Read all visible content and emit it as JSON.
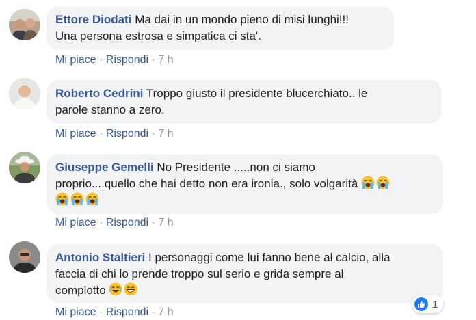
{
  "comments": [
    {
      "author": "Ettore Diodati",
      "line1": "Ma dai in un mondo pieno di misi lunghi!!!",
      "line2": "Una persona estrosa e simpatica ci sta'.",
      "like": "Mi piace",
      "reply": "Rispondi",
      "time": "7 h"
    },
    {
      "author": "Roberto Cedrini",
      "line1": "Troppo giusto il presidente blucerchiato.. le",
      "line2": "parole stanno a zero.",
      "like": "Mi piace",
      "reply": "Rispondi",
      "time": "7 h"
    },
    {
      "author": "Giuseppe Gemelli",
      "line1": "No Presidente .....non ci siamo",
      "line2": "proprio....quello che hai detto non era ironia., solo volgarità",
      "like": "Mi piace",
      "reply": "Rispondi",
      "time": "7 h"
    },
    {
      "author": "Antonio Staltieri",
      "line1": "I personaggi come lui fanno bene al calcio, alla",
      "line2": "faccia di chi lo prende troppo sul serio e grida sempre al",
      "line3": "complotto",
      "like": "Mi piace",
      "reply": "Rispondi",
      "time": "7 h",
      "reaction_count": "1"
    }
  ],
  "separator": "·",
  "icons": {
    "crying": "loudly-crying-face-icon",
    "laughing": "face-with-tears-of-joy-icon",
    "grinning": "grinning-face-icon",
    "like": "thumbs-up-icon"
  },
  "colors": {
    "author": "#385898",
    "bubble": "#f2f3f5",
    "muted": "#90949c",
    "like_blue": "#2078f4"
  }
}
